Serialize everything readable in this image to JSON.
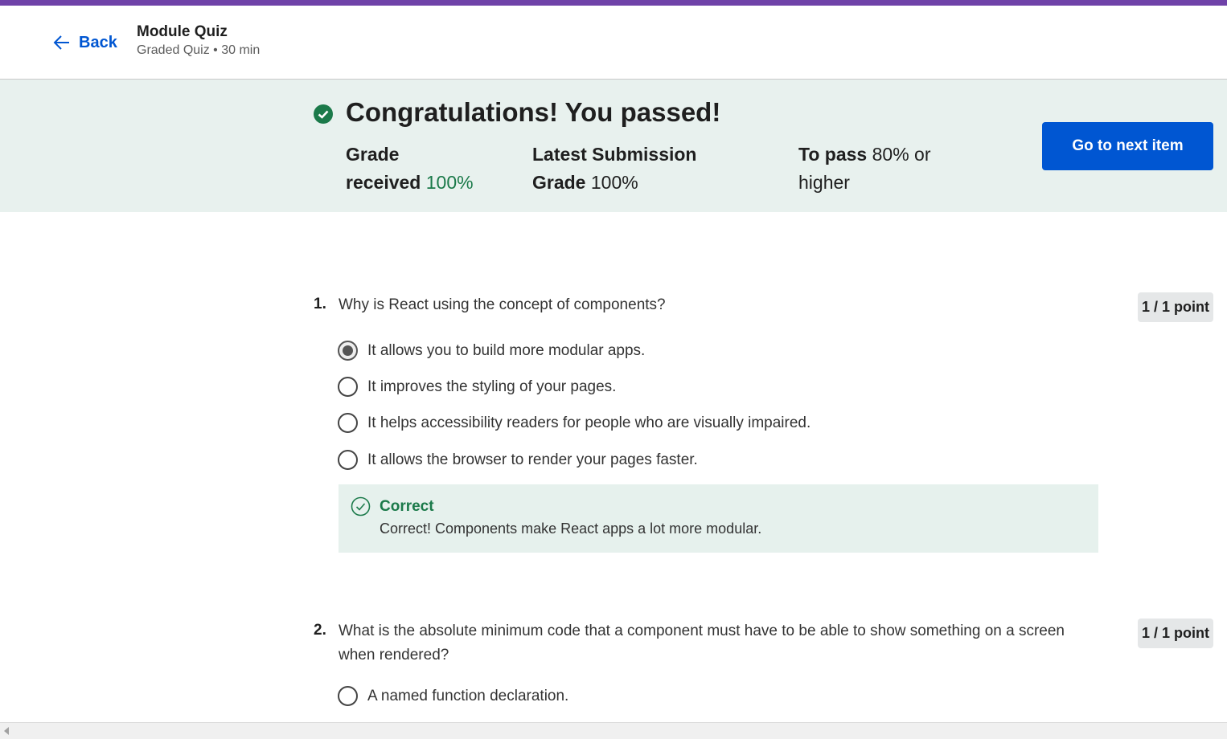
{
  "header": {
    "back_label": "Back",
    "title": "Module Quiz",
    "subtitle": "Graded Quiz • 30 min"
  },
  "banner": {
    "title": "Congratulations! You passed!",
    "grade_received_label_1": "Grade",
    "grade_received_label_2": "received",
    "grade_received_value": "100%",
    "latest_label_1": "Latest Submission",
    "latest_label_2": "Grade",
    "latest_value": "100%",
    "to_pass_label": "To pass",
    "to_pass_value": "80% or",
    "to_pass_value_2": "higher",
    "next_button": "Go to next item"
  },
  "questions": [
    {
      "number": "1.",
      "text": "Why is React using the concept of components?",
      "points": "1 / 1 point",
      "options": [
        {
          "label": "It allows you to build more modular apps.",
          "selected": true
        },
        {
          "label": "It improves the styling of your pages.",
          "selected": false
        },
        {
          "label": "It helps accessibility readers for people who are visually impaired.",
          "selected": false
        },
        {
          "label": "It allows the browser to render your pages faster.",
          "selected": false
        }
      ],
      "feedback": {
        "title": "Correct",
        "text": "Correct! Components make React apps a lot more modular."
      }
    },
    {
      "number": "2.",
      "text": "What is the absolute minimum code that a component must have to be able to show something on a screen when rendered?",
      "points": "1 / 1 point",
      "options": [
        {
          "label": "A named function declaration.",
          "selected": false
        }
      ]
    }
  ],
  "colors": {
    "accent_purple": "#6f42a8",
    "primary_blue": "#0056d2",
    "success_green": "#1b7a4a",
    "banner_bg": "#e8f1ee"
  }
}
